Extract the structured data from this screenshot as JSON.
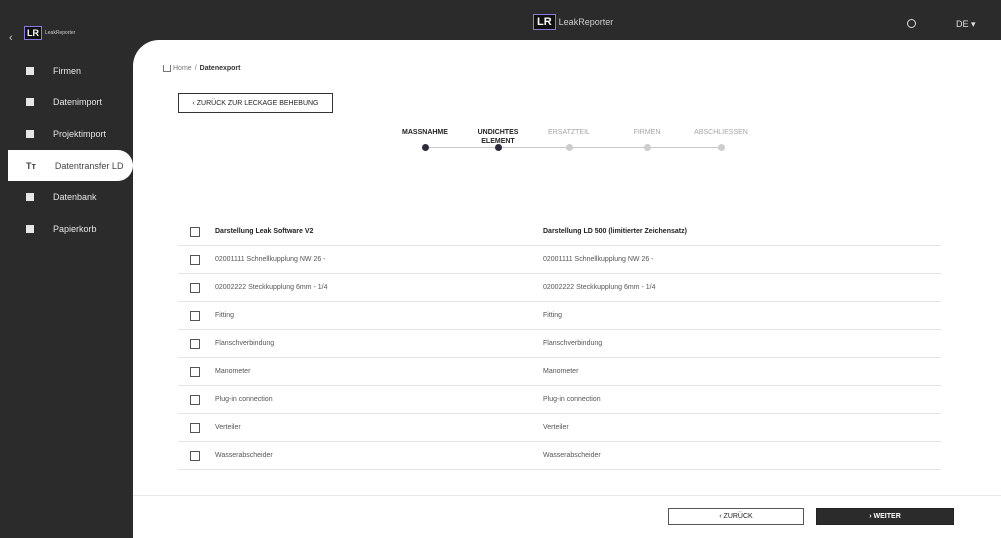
{
  "app": {
    "logo_mark": "LR",
    "name": "LeakReporter",
    "language": "DE ▾"
  },
  "sidebar": {
    "items": [
      {
        "label": "Firmen",
        "icon": "building-icon"
      },
      {
        "label": "Datenimport",
        "icon": "import-icon"
      },
      {
        "label": "Projektimport",
        "icon": "briefcase-icon"
      },
      {
        "label": "Datentransfer LD",
        "icon": "text-size-icon",
        "icon_glyph": "Tт",
        "active": true
      },
      {
        "label": "Datenbank",
        "icon": "database-icon"
      },
      {
        "label": "Papierkorb",
        "icon": "trash-icon"
      }
    ]
  },
  "breadcrumb": {
    "home": "Home",
    "separator": "/",
    "current": "Datenexport"
  },
  "back_button": "‹  ZURÜCK ZUR LECKAGE BEHEBUNG",
  "steps": [
    {
      "label": "MASSNAHME",
      "state": "done"
    },
    {
      "label": "UNDICHTES ELEMENT",
      "state": "done"
    },
    {
      "label": "ERSATZTEIL",
      "state": "todo"
    },
    {
      "label": "FIRMEN",
      "state": "todo"
    },
    {
      "label": "ABSCHLIESSEN",
      "state": "todo"
    }
  ],
  "table": {
    "headers": [
      "Darstellung Leak Software V2",
      "Darstellung LD 500 (limitierter Zeichensatz)"
    ],
    "rows": [
      [
        "02001111 Schnellkupplung NW 26 -",
        "02001111 Schnellkupplung NW 26 -"
      ],
      [
        "02002222 Steckkupplung 6mm - 1/4",
        "02002222 Steckkupplung 6mm - 1/4"
      ],
      [
        "Fitting",
        "Fitting"
      ],
      [
        "Flanschverbindung",
        "Flanschverbindung"
      ],
      [
        "Manometer",
        "Manometer"
      ],
      [
        "Plug-in connection",
        "Plug-in connection"
      ],
      [
        "Verteiler",
        "Verteiler"
      ],
      [
        "Wasserabscheider",
        "Wasserabscheider"
      ]
    ]
  },
  "footer": {
    "back_label": "‹  ZURÜCK",
    "next_label": "›  WEITER"
  },
  "colors": {
    "sidebar_bg": "#2b2b2b",
    "accent": "#8a7be0",
    "primary_button": "#2b2b2b"
  }
}
